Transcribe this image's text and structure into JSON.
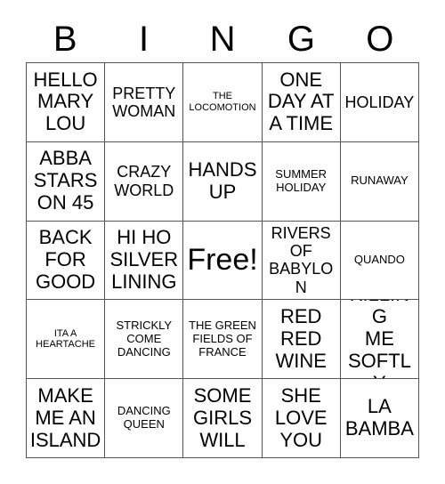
{
  "card": {
    "header_letters": [
      "B",
      "I",
      "N",
      "G",
      "O"
    ],
    "grid": {
      "columns": 5,
      "rows": 5,
      "border_color": "#555555",
      "background_color": "#ffffff",
      "text_color": "#000000"
    },
    "cells": [
      {
        "text": "HELLO\nMARY\nLOU",
        "size": "size-lg",
        "row": 1,
        "col": 1,
        "free": false
      },
      {
        "text": "PRETTY\nWOMAN",
        "size": "size-md",
        "row": 1,
        "col": 2,
        "free": false
      },
      {
        "text": "THE\nLOCOMOTION",
        "size": "size-xs",
        "row": 1,
        "col": 3,
        "free": false
      },
      {
        "text": "ONE\nDAY AT\nA TIME",
        "size": "size-lg",
        "row": 1,
        "col": 4,
        "free": false
      },
      {
        "text": "HOLIDAY",
        "size": "size-md",
        "row": 1,
        "col": 5,
        "free": false
      },
      {
        "text": "ABBA\nSTARS\nON 45",
        "size": "size-lg",
        "row": 2,
        "col": 1,
        "free": false
      },
      {
        "text": "CRAZY\nWORLD",
        "size": "size-md",
        "row": 2,
        "col": 2,
        "free": false
      },
      {
        "text": "HANDS\nUP",
        "size": "size-lg",
        "row": 2,
        "col": 3,
        "free": false
      },
      {
        "text": "SUMMER\nHOLIDAY",
        "size": "size-sm",
        "row": 2,
        "col": 4,
        "free": false
      },
      {
        "text": "RUNAWAY",
        "size": "size-sm",
        "row": 2,
        "col": 5,
        "free": false
      },
      {
        "text": "BACK\nFOR\nGOOD",
        "size": "size-lg",
        "row": 3,
        "col": 1,
        "free": false
      },
      {
        "text": "HI HO\nSILVER\nLINING",
        "size": "size-lg",
        "row": 3,
        "col": 2,
        "free": false
      },
      {
        "text": "Free!",
        "size": "size-free",
        "row": 3,
        "col": 3,
        "free": true
      },
      {
        "text": "RIVERS\nOF\nBABYLON",
        "size": "size-md",
        "row": 3,
        "col": 4,
        "free": false
      },
      {
        "text": "QUANDO",
        "size": "size-sm",
        "row": 3,
        "col": 5,
        "free": false
      },
      {
        "text": "ITA A\nHEARTACHE",
        "size": "size-xs",
        "row": 4,
        "col": 1,
        "free": false
      },
      {
        "text": "STRICKLY\nCOME\nDANCING",
        "size": "size-sm",
        "row": 4,
        "col": 2,
        "free": false
      },
      {
        "text": "THE GREEN\nFIELDS OF\nFRANCE",
        "size": "size-sm",
        "row": 4,
        "col": 3,
        "free": false
      },
      {
        "text": "RED\nRED\nWINE",
        "size": "size-lg",
        "row": 4,
        "col": 4,
        "free": false
      },
      {
        "text": "KILLING\nME\nSOFTLY",
        "size": "size-lg",
        "row": 4,
        "col": 5,
        "free": false
      },
      {
        "text": "MAKE\nME AN\nISLAND",
        "size": "size-lg",
        "row": 5,
        "col": 1,
        "free": false
      },
      {
        "text": "DANCING\nQUEEN",
        "size": "size-sm",
        "row": 5,
        "col": 2,
        "free": false
      },
      {
        "text": "SOME\nGIRLS\nWILL",
        "size": "size-lg",
        "row": 5,
        "col": 3,
        "free": false
      },
      {
        "text": "SHE\nLOVE\nYOU",
        "size": "size-lg",
        "row": 5,
        "col": 4,
        "free": false
      },
      {
        "text": "LA\nBAMBA",
        "size": "size-lg",
        "row": 5,
        "col": 5,
        "free": false
      }
    ]
  }
}
